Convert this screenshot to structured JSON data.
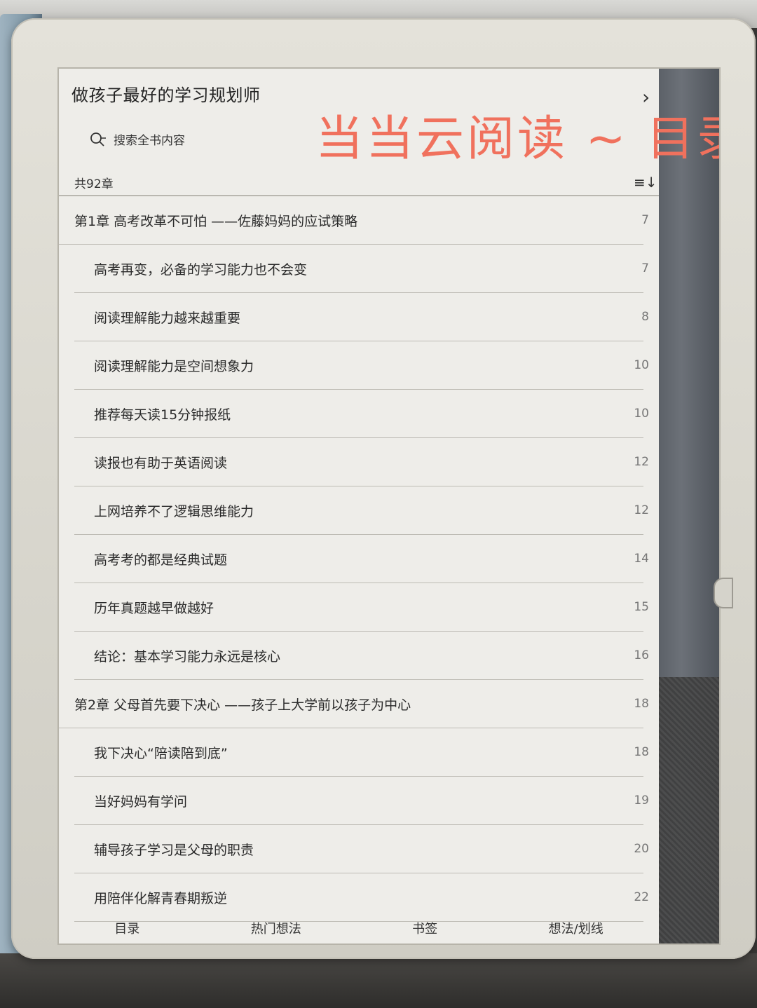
{
  "book": {
    "title": "做孩子最好的学习规划师"
  },
  "search": {
    "label": "搜索全书内容"
  },
  "overlay": {
    "title": "当当云阅读 ~ 目录"
  },
  "toc": {
    "chapter_count": "共92章",
    "items": [
      {
        "type": "chapter",
        "label": "第1章 高考改革不可怕 ——佐藤妈妈的应试策略",
        "page": "7"
      },
      {
        "type": "section",
        "label": "高考再变，必备的学习能力也不会变",
        "page": "7"
      },
      {
        "type": "section",
        "label": "阅读理解能力越来越重要",
        "page": "8"
      },
      {
        "type": "section",
        "label": "阅读理解能力是空间想象力",
        "page": "10"
      },
      {
        "type": "section",
        "label": "推荐每天读15分钟报纸",
        "page": "10"
      },
      {
        "type": "section",
        "label": "读报也有助于英语阅读",
        "page": "12"
      },
      {
        "type": "section",
        "label": "上网培养不了逻辑思维能力",
        "page": "12"
      },
      {
        "type": "section",
        "label": "高考考的都是经典试题",
        "page": "14"
      },
      {
        "type": "section",
        "label": "历年真题越早做越好",
        "page": "15"
      },
      {
        "type": "section",
        "label": "结论：基本学习能力永远是核心",
        "page": "16"
      },
      {
        "type": "chapter",
        "label": "第2章 父母首先要下决心 ——孩子上大学前以孩子为中心",
        "page": "18"
      },
      {
        "type": "section",
        "label": "我下决心“陪读陪到底”",
        "page": "18"
      },
      {
        "type": "section",
        "label": "当好妈妈有学问",
        "page": "19"
      },
      {
        "type": "section",
        "label": "辅导孩子学习是父母的职责",
        "page": "20"
      },
      {
        "type": "section",
        "label": "用陪伴化解青春期叛逆",
        "page": "22"
      }
    ]
  },
  "tabs": [
    {
      "label": "目录",
      "active": true
    },
    {
      "label": "热门想法",
      "active": false
    },
    {
      "label": "书签",
      "active": false
    },
    {
      "label": "想法/划线",
      "active": false
    }
  ],
  "icons": {
    "search": "search-icon",
    "forward": "chevron-right-icon",
    "sort": "sort-order-icon"
  },
  "colors": {
    "overlay_text": "#f0715d"
  }
}
